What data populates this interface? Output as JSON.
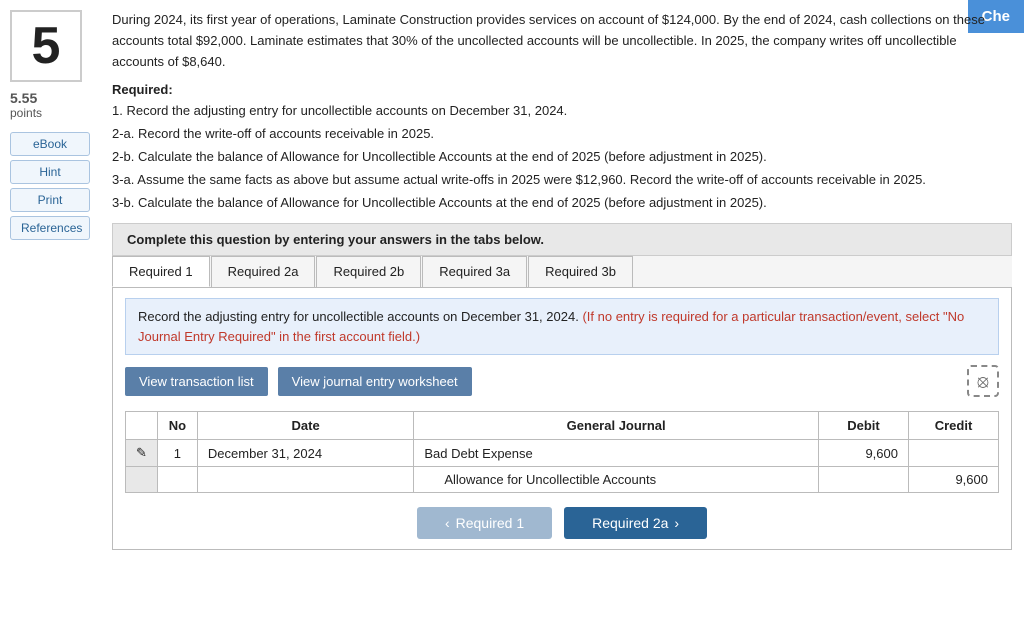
{
  "check_button": "Che",
  "problem_number": "5",
  "points_value": "5.55",
  "points_label": "points",
  "left_links": [
    "eBook",
    "Hint",
    "Print",
    "References"
  ],
  "problem_text": "During 2024, its first year of operations, Laminate Construction provides services on account of $124,000. By the end of 2024, cash collections on these accounts total $92,000. Laminate estimates that 30% of the uncollected accounts will be uncollectible. In 2025, the company writes off uncollectible accounts of $8,640.",
  "required_label": "Required:",
  "requirements": [
    "1. Record the adjusting entry for uncollectible accounts on December 31, 2024.",
    "2-a. Record the write-off of accounts receivable in 2025.",
    "2-b. Calculate the balance of Allowance for Uncollectible Accounts at the end of 2025 (before adjustment in 2025).",
    "3-a. Assume the same facts as above but assume actual write-offs in 2025 were $12,960. Record the write-off of accounts receivable in 2025.",
    "3-b. Calculate the balance of Allowance for Uncollectible Accounts at the end of 2025 (before adjustment in 2025)."
  ],
  "complete_box_text": "Complete this question by entering your answers in the tabs below.",
  "tabs": [
    {
      "label": "Required 1",
      "active": true
    },
    {
      "label": "Required 2a",
      "active": false
    },
    {
      "label": "Required 2b",
      "active": false
    },
    {
      "label": "Required 3a",
      "active": false
    },
    {
      "label": "Required 3b",
      "active": false
    }
  ],
  "instruction_main": "Record the adjusting entry for uncollectible accounts on December 31, 2024.",
  "instruction_note": "(If no entry is required for a particular transaction/event, select \"No Journal Entry Required\" in the first account field.)",
  "buttons": {
    "view_transaction": "View transaction list",
    "view_journal": "View journal entry worksheet"
  },
  "table": {
    "headers": [
      "No",
      "Date",
      "General Journal",
      "Debit",
      "Credit"
    ],
    "rows": [
      {
        "no": "1",
        "date": "December 31, 2024",
        "account": "Bad Debt Expense",
        "debit": "9,600",
        "credit": ""
      },
      {
        "no": "",
        "date": "",
        "account": "Allowance for Uncollectible Accounts",
        "debit": "",
        "credit": "9,600"
      }
    ]
  },
  "nav": {
    "prev_label": "Required 1",
    "next_label": "Required 2a"
  }
}
